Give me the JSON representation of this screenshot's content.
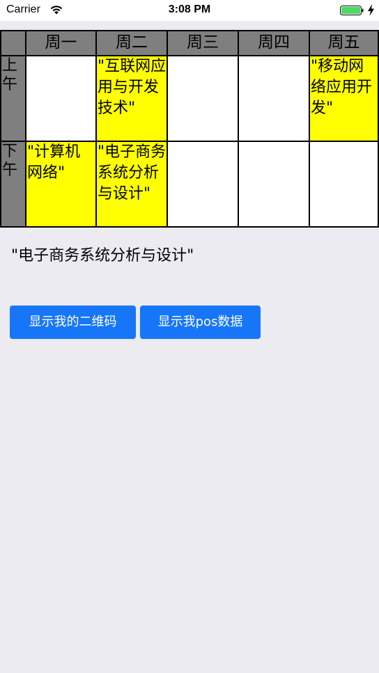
{
  "status_bar": {
    "carrier": "Carrier",
    "time": "3:08 PM"
  },
  "timetable": {
    "days": [
      "周一",
      "周二",
      "周三",
      "周四",
      "周五"
    ],
    "periods": [
      "上午",
      "下午"
    ],
    "rows": [
      [
        "",
        "\"互联网应用与开发技术\"",
        "",
        "",
        "\"移动网络应用开发\""
      ],
      [
        "\"计算机网络\"",
        "\"电子商务系统分析与设计\"",
        "",
        "",
        ""
      ]
    ],
    "highlight_color": "#ffff00",
    "header_color": "#7f7f7f"
  },
  "selected_course": "\"电子商务系统分析与设计\"",
  "buttons": {
    "show_qr": "显示我的二维码",
    "show_pos": "显示我pos数据"
  },
  "colors": {
    "accent": "#1676f7",
    "background": "#ebebf1"
  }
}
